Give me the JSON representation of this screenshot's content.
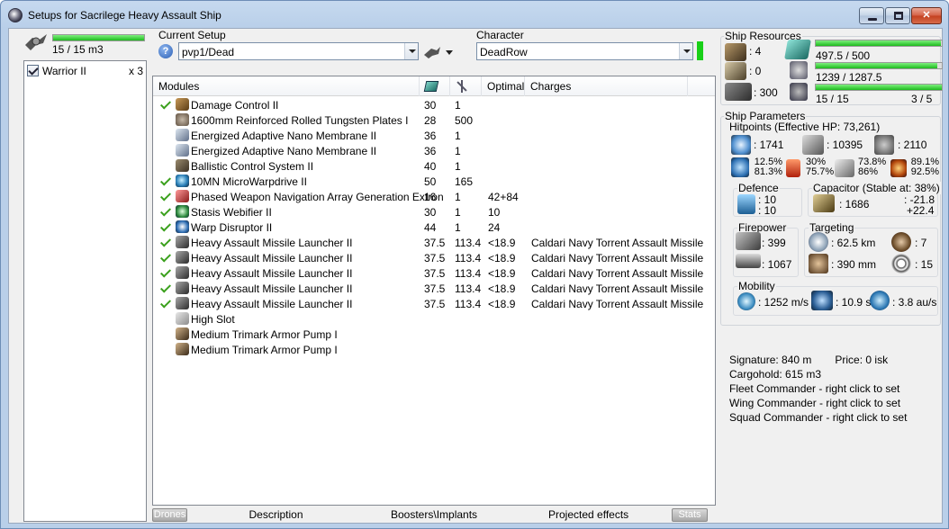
{
  "window": {
    "title": "Setups for Sacrilege Heavy Assault Ship"
  },
  "drones": {
    "volume": "15 / 15 m3",
    "fill": 1.0,
    "items": [
      {
        "name": "Warrior II",
        "qty": "x 3",
        "checked": true
      }
    ]
  },
  "setup": {
    "label": "Current Setup",
    "value": "pvp1/Dead"
  },
  "character": {
    "label": "Character",
    "value": "DeadRow",
    "status_color": "#18d018"
  },
  "modules": {
    "headers": {
      "name": "Modules",
      "optimal": "Optimal",
      "charges": "Charges"
    },
    "rows": [
      {
        "ok": true,
        "icon": "damage-control-icon",
        "cls": "ic-dc",
        "name": "Damage Control II",
        "cpu": "30",
        "pg": "1",
        "optimal": "",
        "charge": ""
      },
      {
        "ok": false,
        "icon": "armor-plate-icon",
        "cls": "ic-pl",
        "name": "1600mm Reinforced Rolled Tungsten Plates I",
        "cpu": "28",
        "pg": "500",
        "optimal": "",
        "charge": ""
      },
      {
        "ok": false,
        "icon": "membrane-icon",
        "cls": "ic-mem",
        "name": "Energized Adaptive Nano Membrane II",
        "cpu": "36",
        "pg": "1",
        "optimal": "",
        "charge": ""
      },
      {
        "ok": false,
        "icon": "membrane-icon",
        "cls": "ic-mem",
        "name": "Energized Adaptive Nano Membrane II",
        "cpu": "36",
        "pg": "1",
        "optimal": "",
        "charge": ""
      },
      {
        "ok": false,
        "icon": "ballistic-control-icon",
        "cls": "ic-bcs",
        "name": "Ballistic Control System II",
        "cpu": "40",
        "pg": "1",
        "optimal": "",
        "charge": ""
      },
      {
        "ok": true,
        "icon": "microwarpdrive-icon",
        "cls": "ic-mwd",
        "name": "10MN MicroWarpdrive II",
        "cpu": "50",
        "pg": "165",
        "optimal": "",
        "charge": ""
      },
      {
        "ok": true,
        "icon": "web-navigation-icon",
        "cls": "ic-pw",
        "name": "Phased Weapon Navigation Array Generation Extron",
        "cpu": "16",
        "pg": "1",
        "optimal": "42+84",
        "charge": ""
      },
      {
        "ok": true,
        "icon": "stasis-webifier-icon",
        "cls": "ic-web",
        "name": "Stasis Webifier II",
        "cpu": "30",
        "pg": "1",
        "optimal": "10",
        "charge": ""
      },
      {
        "ok": true,
        "icon": "warp-disruptor-icon",
        "cls": "ic-wd",
        "name": "Warp Disruptor II",
        "cpu": "44",
        "pg": "1",
        "optimal": "24",
        "charge": ""
      },
      {
        "ok": true,
        "icon": "missile-launcher-icon",
        "cls": "ic-hml",
        "name": "Heavy Assault Missile Launcher II",
        "cpu": "37.5",
        "pg": "113.4",
        "optimal": "<18.9",
        "charge": "Caldari Navy Torrent Assault Missile"
      },
      {
        "ok": true,
        "icon": "missile-launcher-icon",
        "cls": "ic-hml",
        "name": "Heavy Assault Missile Launcher II",
        "cpu": "37.5",
        "pg": "113.4",
        "optimal": "<18.9",
        "charge": "Caldari Navy Torrent Assault Missile"
      },
      {
        "ok": true,
        "icon": "missile-launcher-icon",
        "cls": "ic-hml",
        "name": "Heavy Assault Missile Launcher II",
        "cpu": "37.5",
        "pg": "113.4",
        "optimal": "<18.9",
        "charge": "Caldari Navy Torrent Assault Missile"
      },
      {
        "ok": true,
        "icon": "missile-launcher-icon",
        "cls": "ic-hml",
        "name": "Heavy Assault Missile Launcher II",
        "cpu": "37.5",
        "pg": "113.4",
        "optimal": "<18.9",
        "charge": "Caldari Navy Torrent Assault Missile"
      },
      {
        "ok": true,
        "icon": "missile-launcher-icon",
        "cls": "ic-hml",
        "name": "Heavy Assault Missile Launcher II",
        "cpu": "37.5",
        "pg": "113.4",
        "optimal": "<18.9",
        "charge": "Caldari Navy Torrent Assault Missile"
      },
      {
        "ok": false,
        "icon": "high-slot-icon",
        "cls": "ic-hs",
        "name": "High Slot",
        "cpu": "",
        "pg": "",
        "optimal": "",
        "charge": ""
      },
      {
        "ok": false,
        "icon": "armor-pump-icon",
        "cls": "ic-ap",
        "name": "Medium Trimark Armor Pump I",
        "cpu": "",
        "pg": "",
        "optimal": "",
        "charge": ""
      },
      {
        "ok": false,
        "icon": "armor-pump-icon",
        "cls": "ic-ap",
        "name": "Medium Trimark Armor Pump I",
        "cpu": "",
        "pg": "",
        "optimal": "",
        "charge": ""
      }
    ]
  },
  "tabs": {
    "drones": "Drones",
    "description": "Description",
    "boosters": "Boosters\\Implants",
    "projected": "Projected effects",
    "stats": "Stats"
  },
  "resources": {
    "title": "Ship Resources",
    "turret": ": 4",
    "launcher": ": 0",
    "calibration": ": 300",
    "cpu": "497.5 / 500",
    "cpu_fill": 0.995,
    "powergrid": "1239 / 1287.5",
    "powergrid_fill": 0.962,
    "drone_bay": "15 / 15",
    "drone_bay_fill": 1.0,
    "drones_active": "3 / 5"
  },
  "parameters": {
    "title": "Ship Parameters",
    "hitpoints_title": "Hitpoints (Effective HP: 73,261)",
    "shield_hp": ": 1741",
    "armor_hp": ": 10395",
    "structure_hp": ": 2110",
    "shield_em": "12.5%",
    "shield_th": "81.3%",
    "armor_em": "30%",
    "armor_th": "75.7%",
    "armor_kin": "73.8%",
    "armor_kin2": "86%",
    "armor_ex": "89.1%",
    "armor_ex2": "92.5%",
    "defence_title": "Defence",
    "defence_a": ": 10",
    "defence_b": ": 10",
    "capacitor_title": "Capacitor (Stable at: 38%)",
    "capacitor": ": 1686",
    "cap_delta_a": ": -21.8",
    "cap_delta_b": "+22.4",
    "firepower_title": "Firepower",
    "firepower_a": ": 399",
    "firepower_b": ": 1067",
    "targeting_title": "Targeting",
    "targeting_range": ": 62.5 km",
    "targeting_sig": ": 390 mm",
    "targeting_max": ": 7",
    "targeting_sensor": ": 15",
    "mobility_title": "Mobility",
    "velocity": ": 1252 m/s",
    "align": ": 10.9 s",
    "warp": ": 3.8 au/s"
  },
  "info": {
    "signature": "Signature: 840 m",
    "price": "Price: 0 isk",
    "cargo": "Cargohold: 615 m3",
    "fleet": "Fleet Commander - right click to set",
    "wing": "Wing Commander - right click to set",
    "squad": "Squad Commander - right click to set"
  }
}
